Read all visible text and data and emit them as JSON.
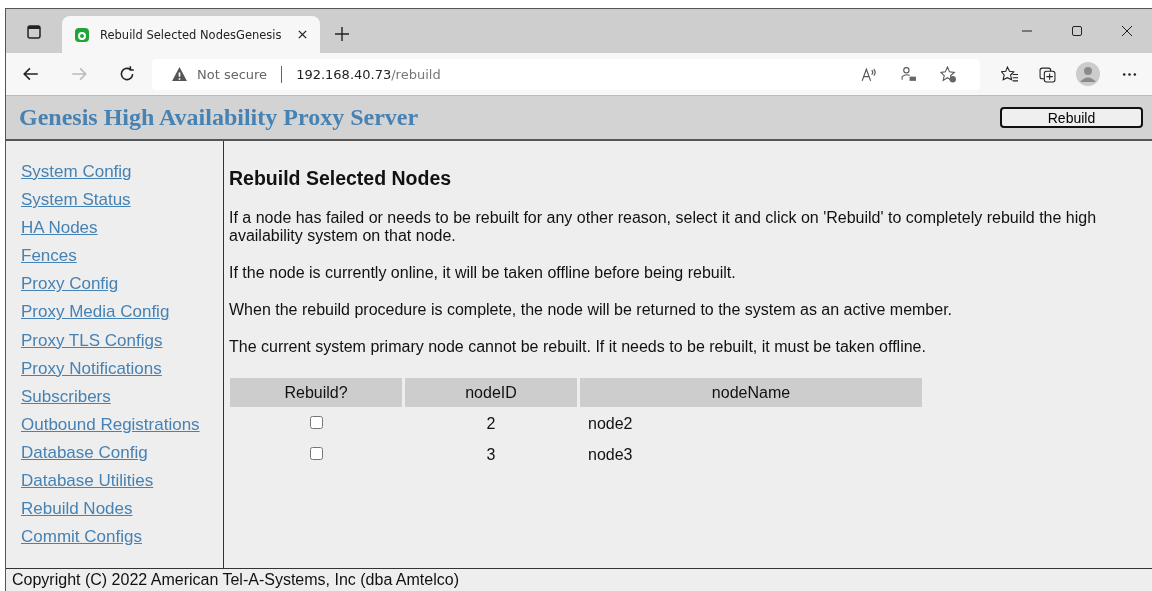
{
  "browser": {
    "tab_title": "Rebuild Selected NodesGenesis",
    "url_host": "192.168.40.73",
    "url_path": "/rebuild",
    "security": "Not secure"
  },
  "header": {
    "title": "Genesis High Availability Proxy Server",
    "button": "Rebuild"
  },
  "sidebar": {
    "items": [
      "System Config",
      "System Status",
      "HA Nodes",
      "Fences",
      "Proxy Config",
      "Proxy Media Config",
      "Proxy TLS Configs",
      "Proxy Notifications",
      "Subscribers",
      "Outbound Registrations",
      "Database Config",
      "Database Utilities",
      "Rebuild Nodes",
      "Commit Configs"
    ]
  },
  "content": {
    "heading": "Rebuild Selected Nodes",
    "paragraphs": [
      "If a node has failed or needs to be rebuilt for any other reason, select it and click on 'Rebuild' to completely rebuild the high availability system on that node.",
      "If the node is currently online, it will be taken offline before being rebuilt.",
      "When the rebuild procedure is complete, the node will be returned to the system as an active member.",
      "The current system primary node cannot be rebuilt. If it needs to be rebuilt, it must be taken offline."
    ]
  },
  "table": {
    "columns": [
      "Rebuild?",
      "nodeID",
      "nodeName"
    ],
    "rows": [
      {
        "checked": false,
        "node_id": "2",
        "node_name": "node2"
      },
      {
        "checked": false,
        "node_id": "3",
        "node_name": "node3"
      }
    ]
  },
  "footer": "Copyright (C) 2022 American Tel-A-Systems, Inc (dba Amtelco)"
}
